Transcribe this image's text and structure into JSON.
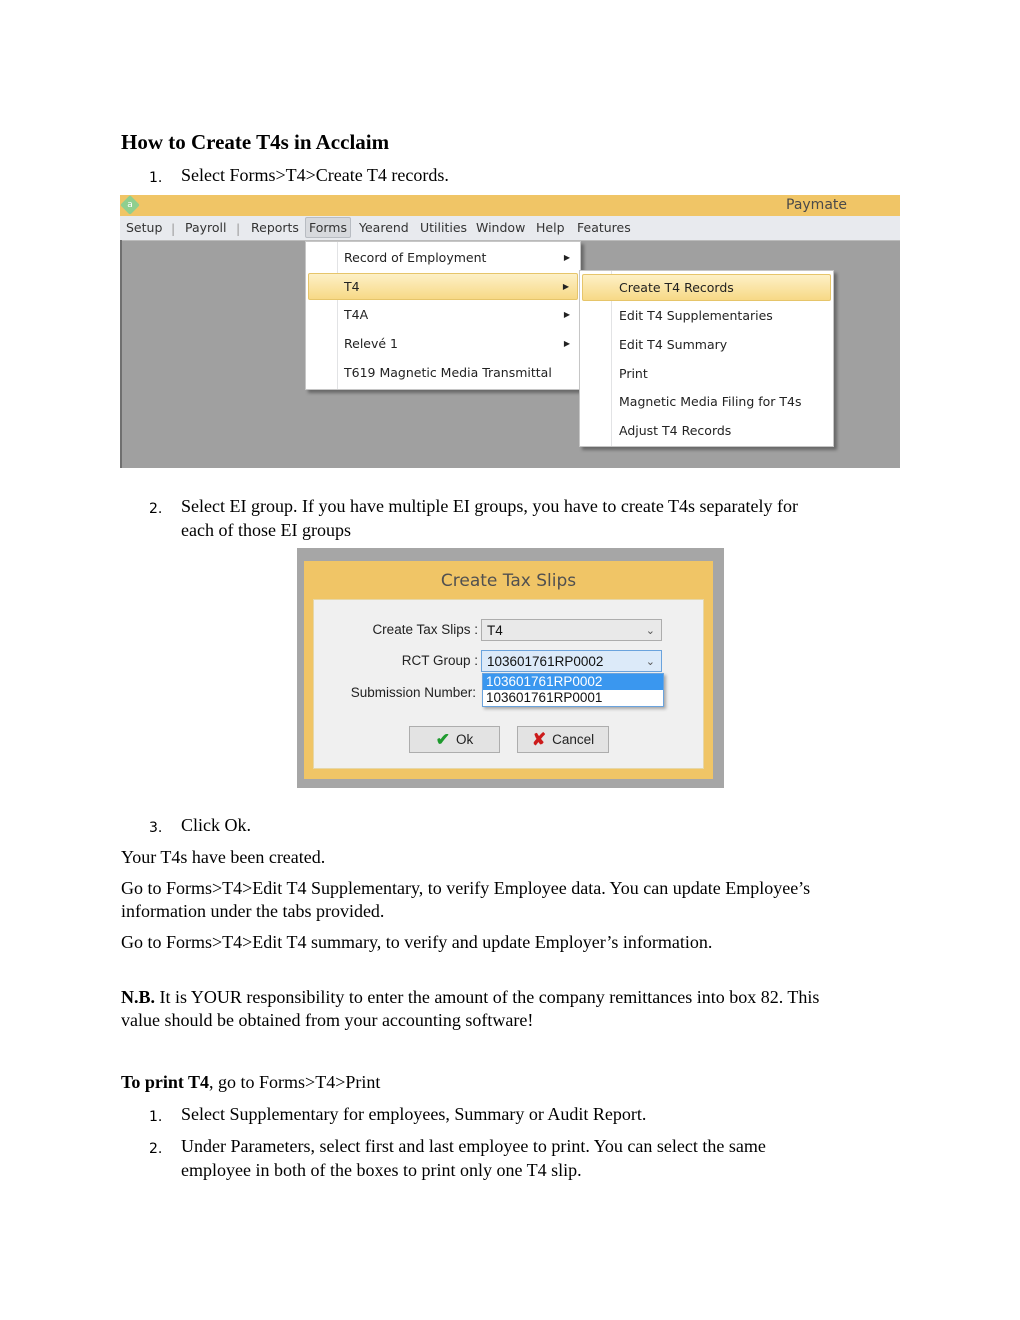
{
  "document": {
    "title": "How to Create T4s in Acclaim",
    "steps_create": [
      {
        "number": "1.",
        "text": "Select Forms>T4>Create T4 records."
      },
      {
        "number": "2.",
        "text_line1": "Select EI group. If you have multiple EI groups, you have to create T4s separately for",
        "text_line2": "each of those EI groups"
      },
      {
        "number": "3.",
        "text": "Click Ok."
      }
    ],
    "created_text": "Your T4s have been created.",
    "edit_supp_line1": "Go to Forms>T4>Edit T4 Supplementary, to verify Employee data. You can update Employee’s",
    "edit_supp_line2": "information under the tabs provided.",
    "edit_summary": "Go to Forms>T4>Edit T4 summary, to verify and update Employer’s information.",
    "nb_bold": "N.B.",
    "nb_line1": " It is YOUR responsibility to enter the amount of the company remittances into box 82. This",
    "nb_line2": "value should be obtained from your accounting software!",
    "print_bold": "To print T4",
    "print_rest": ", go to Forms>T4>Print",
    "steps_print": [
      {
        "number": "1.",
        "text": "Select Supplementary for employees, Summary or Audit Report."
      },
      {
        "number": "2.",
        "text_line1": "Under Parameters, select first and last employee to print. You can select the same",
        "text_line2": "employee in both of the boxes to print only one T4 slip."
      }
    ]
  },
  "app": {
    "name": "Paymate",
    "logo_letter": "a",
    "menu": [
      "Setup",
      "Payroll",
      "Reports",
      "Forms",
      "Yearend",
      "Utilities",
      "Window",
      "Help",
      "Features"
    ],
    "active_menu": "Forms",
    "forms_menu": [
      {
        "label": "Record of Employment",
        "has_submenu": true
      },
      {
        "label": "T4",
        "has_submenu": true,
        "highlighted": true
      },
      {
        "label": "T4A",
        "has_submenu": true
      },
      {
        "label": "Relevé 1",
        "has_submenu": true
      },
      {
        "label": "T619 Magnetic Media Transmittal",
        "has_submenu": false
      }
    ],
    "t4_submenu": [
      {
        "label": "Create T4 Records",
        "highlighted": true
      },
      {
        "label": "Edit T4 Supplementaries"
      },
      {
        "label": "Edit T4 Summary"
      },
      {
        "label": "Print"
      },
      {
        "label": "Magnetic Media Filing for T4s"
      },
      {
        "label": "Adjust T4 Records"
      }
    ],
    "colors": {
      "titlebar": "#f0c566",
      "highlight": "#f7d986",
      "workspace": "#a0a0a0"
    }
  },
  "dialog": {
    "title": "Create Tax Slips",
    "create_tax_slips_label": "Create Tax Slips :",
    "create_tax_slips_value": "T4",
    "rct_group_label": "RCT Group :",
    "rct_group_value": "103601761RP0002",
    "rct_group_options": [
      "103601761RP0002",
      "103601761RP0001"
    ],
    "submission_number_label": "Submission Number:",
    "ok_label": "Ok",
    "cancel_label": "Cancel"
  }
}
